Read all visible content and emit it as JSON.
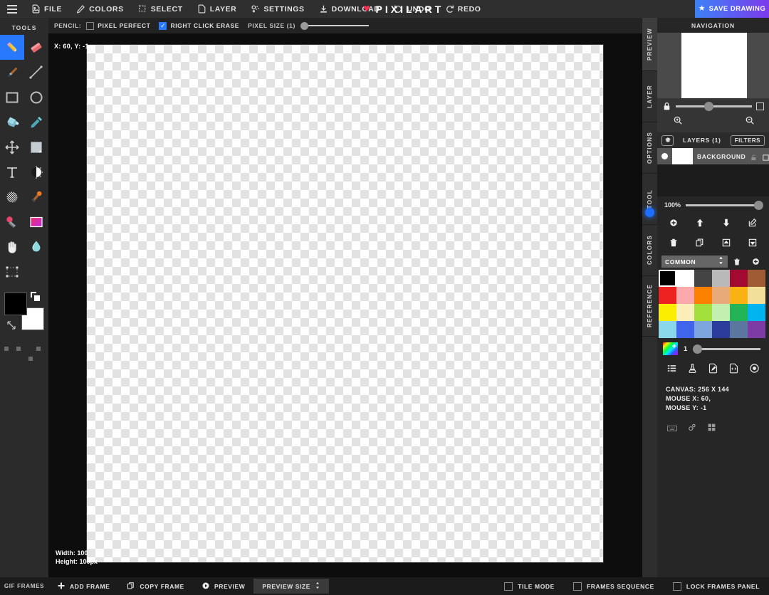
{
  "app": {
    "brand": "PIXILART"
  },
  "topbar": {
    "menu": [
      {
        "label": "FILE",
        "icon": "file-icon"
      },
      {
        "label": "COLORS",
        "icon": "pencil-icon"
      },
      {
        "label": "SELECT",
        "icon": "select-icon"
      },
      {
        "label": "LAYER",
        "icon": "layer-icon"
      },
      {
        "label": "SETTINGS",
        "icon": "settings-icon"
      },
      {
        "label": "DOWNLOAD",
        "icon": "download-icon"
      },
      {
        "label": "UNDO",
        "icon": "undo-icon"
      },
      {
        "label": "REDO",
        "icon": "redo-icon"
      }
    ],
    "save_label": "SAVE DRAWING"
  },
  "optionbar": {
    "tool_label": "PENCIL:",
    "pixel_perfect": {
      "label": "PIXEL PERFECT",
      "checked": false
    },
    "right_click_erase": {
      "label": "RIGHT CLICK ERASE",
      "checked": true
    },
    "pixel_size_label": "PIXEL SIZE (1)",
    "pixel_size_value": 1
  },
  "tools": {
    "title": "TOOLS",
    "items": [
      {
        "name": "pencil-tool",
        "selected": true
      },
      {
        "name": "eraser-tool",
        "selected": false
      },
      {
        "name": "brush-tool",
        "selected": false
      },
      {
        "name": "line-tool",
        "selected": false
      },
      {
        "name": "rectangle-tool",
        "selected": false
      },
      {
        "name": "ellipse-tool",
        "selected": false
      },
      {
        "name": "paint-bucket-tool",
        "selected": false
      },
      {
        "name": "eyedropper-tool",
        "selected": false
      },
      {
        "name": "move-tool",
        "selected": false
      },
      {
        "name": "shade-tool",
        "selected": false
      },
      {
        "name": "text-tool",
        "selected": false
      },
      {
        "name": "lighten-tool",
        "selected": false
      },
      {
        "name": "dither-tool",
        "selected": false
      },
      {
        "name": "stamp-tool",
        "selected": false
      },
      {
        "name": "mirror-tool",
        "selected": false
      },
      {
        "name": "gradient-tool",
        "selected": false
      },
      {
        "name": "pan-tool",
        "selected": false
      },
      {
        "name": "blur-tool",
        "selected": false
      },
      {
        "name": "crop-tool",
        "selected": false
      }
    ],
    "foreground_color": "#000000",
    "background_color": "#ffffff"
  },
  "canvas": {
    "coord_tip": "X: 60, Y: -1",
    "width_label": "Width: 100",
    "height_label": "Height: 100px"
  },
  "right_panel": {
    "vtabs": [
      {
        "label": "PREVIEW",
        "active": true
      },
      {
        "label": "LAYER",
        "active": false
      },
      {
        "label": "OPTIONS",
        "active": false
      },
      {
        "label": "TOOL",
        "active": false
      },
      {
        "label": "COLORS",
        "active": false
      },
      {
        "label": "REFERENCE",
        "active": false
      }
    ],
    "navigation": {
      "title": "NAVIGATION",
      "zoom_value": 37,
      "zoom_in_icon": "zoom-in-icon",
      "zoom_out_icon": "zoom-out-icon",
      "lock_icon": "lock-icon",
      "fit_icon": "fit-square-icon"
    },
    "layers": {
      "title": "LAYERS (1)",
      "filters_label": "FILTERS",
      "gear_icon": "gear-icon",
      "rows": [
        {
          "name": "BACKGROUND",
          "visible": true,
          "locked": false
        }
      ],
      "opacity_label": "100%",
      "opacity_value": 100,
      "buttons": [
        "add-layer-button",
        "move-layer-up-button",
        "move-layer-down-button",
        "edit-layer-button",
        "delete-layer-button",
        "duplicate-layer-button",
        "merge-up-button",
        "merge-down-button"
      ]
    },
    "palette": {
      "name": "COMMON",
      "delete_icon": "trash-icon",
      "add_icon": "add-color-icon",
      "selected_index": 0,
      "colors": [
        "#000000",
        "#ffffff",
        "#444444",
        "#b9b9b9",
        "#a20a32",
        "#a05a34",
        "#ef2222",
        "#fba9ac",
        "#fb8000",
        "#e8aa78",
        "#f9b211",
        "#f2e09a",
        "#fbee00",
        "#faeeb9",
        "#a4e03d",
        "#c3efb1",
        "#22b457",
        "#00b5ef",
        "#8ad6ea",
        "#4065ec",
        "#7ba5dc",
        "#2c3c9c",
        "#5b779f",
        "#7d3ba6"
      ],
      "brush_size": 1,
      "brush_size_value": 1,
      "tool_icons": [
        "palette-list-icon",
        "color-mixer-icon",
        "import-palette-icon",
        "export-palette-icon",
        "color-wheel-icon"
      ]
    },
    "status": {
      "canvas_size": "CANVAS: 256 X 144",
      "mouse_x": "MOUSE X: 60,",
      "mouse_y": "MOUSE Y: -1"
    },
    "footer_icons": [
      "keyboard-icon",
      "settings-gear-icon",
      "grid-icon"
    ]
  },
  "bottombar": {
    "title": "GIF FRAMES",
    "items": [
      {
        "label": "ADD FRAME",
        "icon": "plus-icon"
      },
      {
        "label": "COPY FRAME",
        "icon": "copy-icon"
      },
      {
        "label": "PREVIEW",
        "icon": "play-icon"
      },
      {
        "label": "PREVIEW SIZE",
        "icon": "stepper-icon",
        "boxed": true
      }
    ],
    "checks": [
      {
        "label": "TILE MODE",
        "checked": false
      },
      {
        "label": "FRAMES SEQUENCE",
        "checked": false
      },
      {
        "label": "LOCK FRAMES PANEL",
        "checked": false
      }
    ]
  }
}
